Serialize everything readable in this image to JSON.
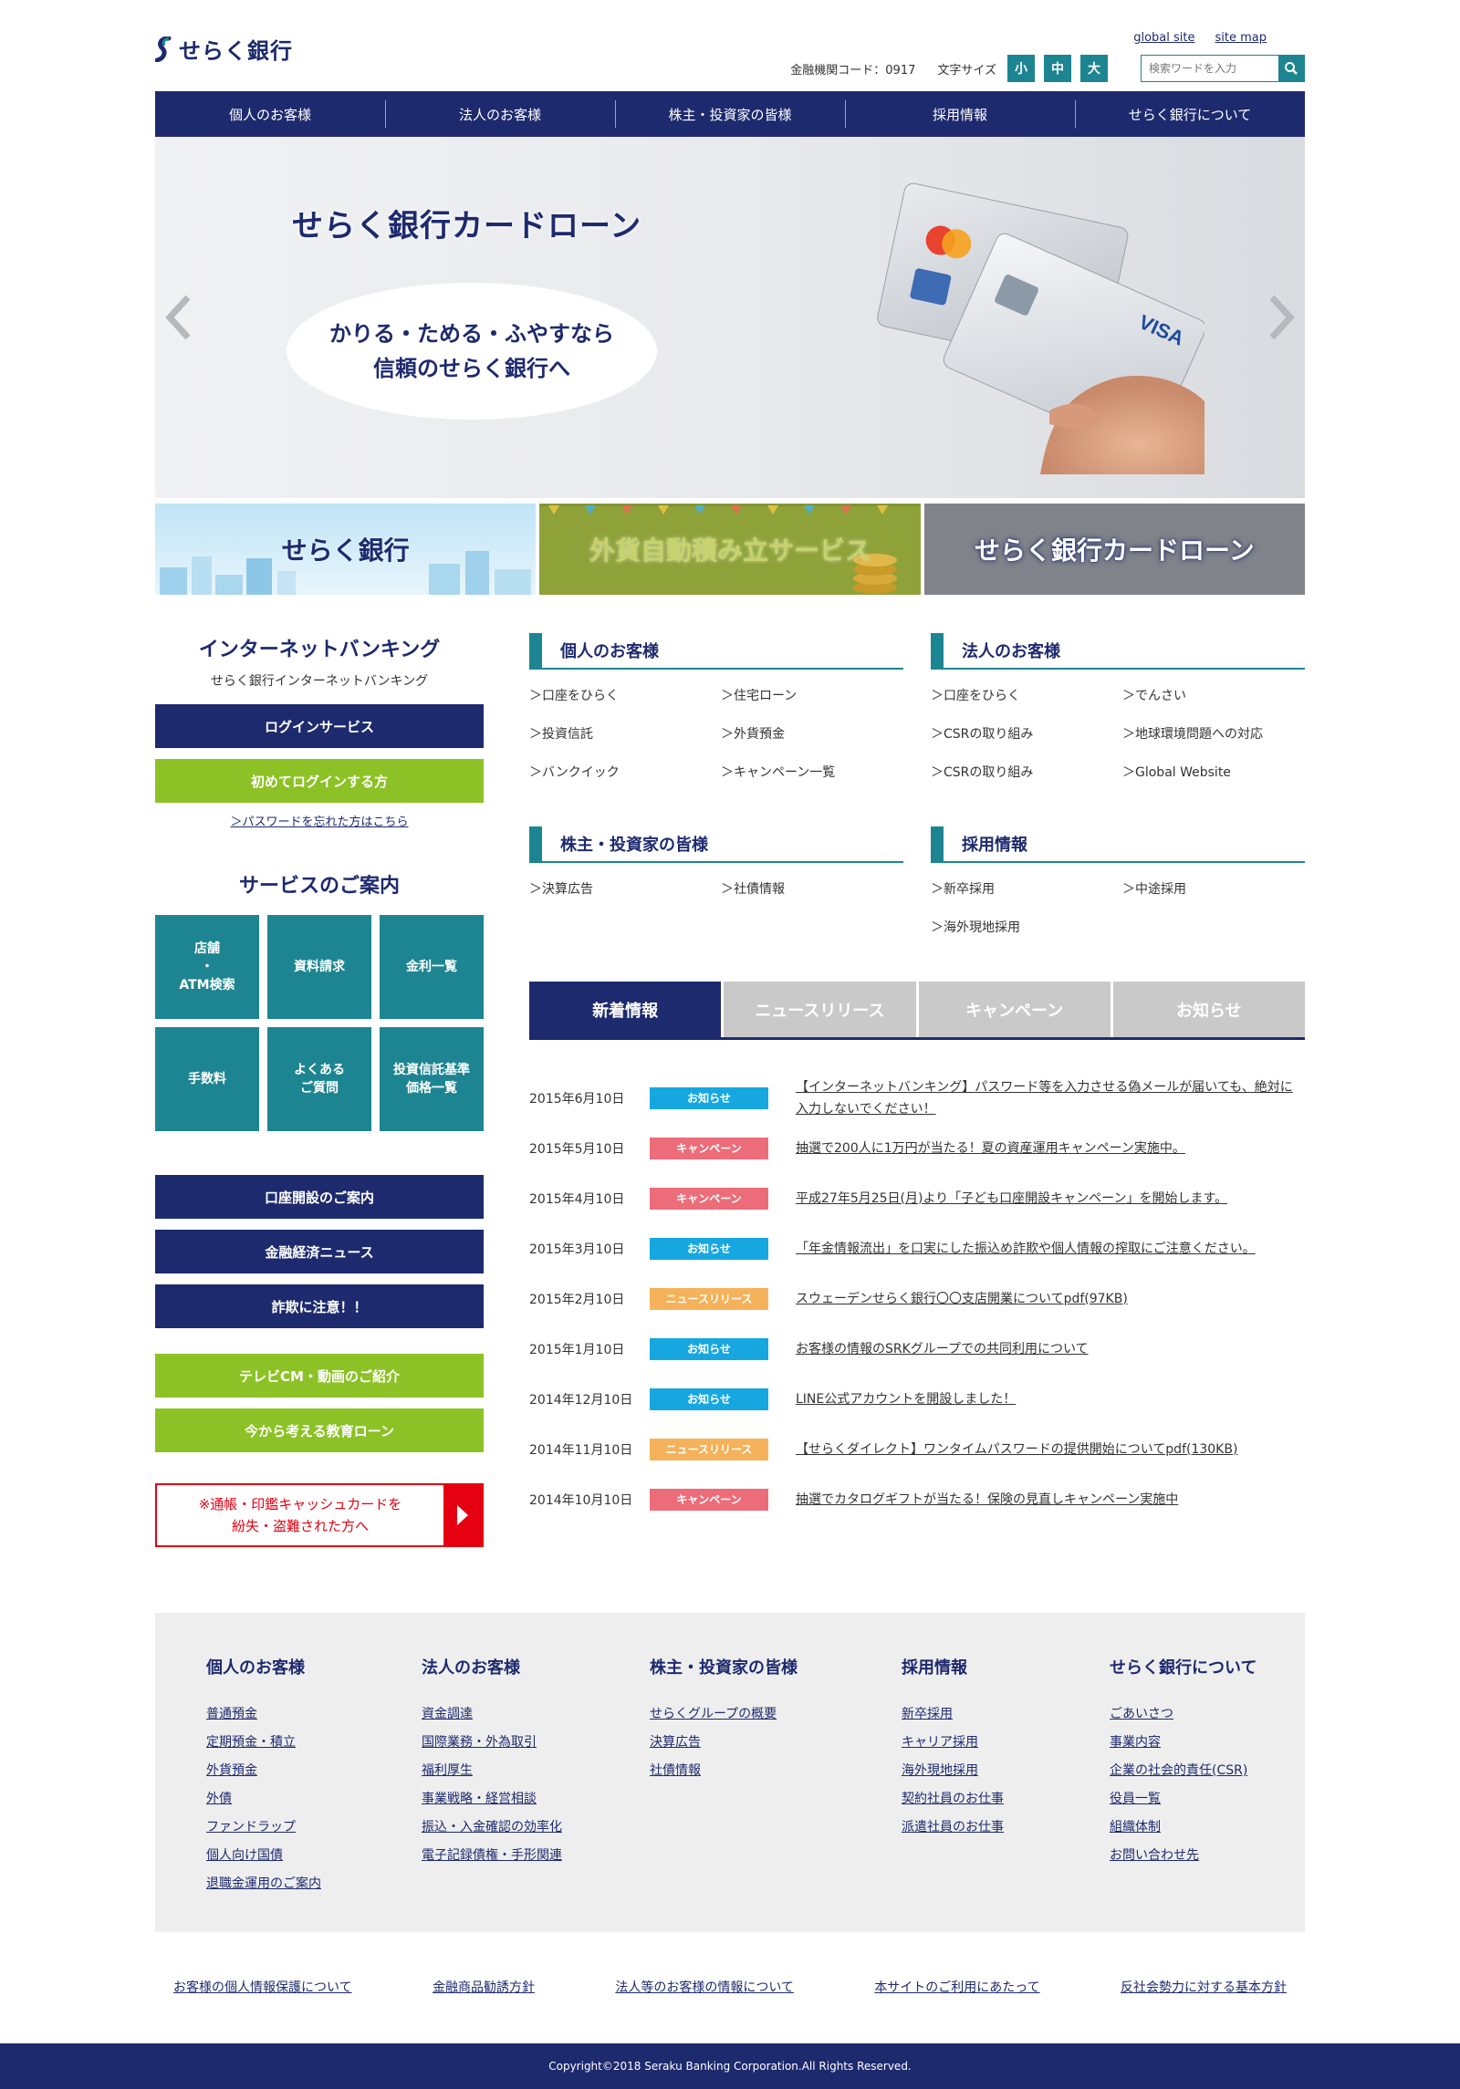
{
  "header": {
    "bank_name": "せらく銀行",
    "links": [
      "global site",
      "site map"
    ],
    "bank_code": "金融機関コード：0917",
    "font_size_label": "文字サイズ",
    "font_sizes": [
      "小",
      "中",
      "大"
    ],
    "search_placeholder": "検索ワードを入力"
  },
  "nav": [
    "個人のお客様",
    "法人のお客様",
    "株主・投資家の皆様",
    "採用情報",
    "せらく銀行について"
  ],
  "hero": {
    "title": "せらく銀行カードローン",
    "catch_line1": "かりる・ためる・ふやすなら",
    "catch_line2": "信頼のせらく銀行へ"
  },
  "banners": [
    "せらく銀行",
    "外貨自動積み立サービス",
    "せらく銀行カードローン"
  ],
  "sidebar": {
    "ib_title": "インターネットバンキング",
    "ib_sub": "せらく銀行インターネットバンキング",
    "login_btn": "ログインサービス",
    "first_login_btn": "初めてログインする方",
    "forgot": "＞パスワードを忘れた方はこちら",
    "service_title": "サービスのご案内",
    "tiles": [
      "店舗\n・\nATM検索",
      "資料請求",
      "金利一覧",
      "手数料",
      "よくある\nご質問",
      "投資信託基準\n価格一覧"
    ],
    "navy_buttons": [
      "口座開設のご案内",
      "金融経済ニュース",
      "詐欺に注意！！"
    ],
    "green_buttons": [
      "テレビCM・動画のご紹介",
      "今から考える教育ローン"
    ],
    "alert": "※通帳・印鑑キャッシュカードを\n紛失・盗難された方へ"
  },
  "sections": [
    {
      "title": "個人のお客様",
      "links": [
        "口座をひらく",
        "住宅ローン",
        "投資信託",
        "外貨預金",
        "バンクイック",
        "キャンペーン一覧"
      ]
    },
    {
      "title": "法人のお客様",
      "links": [
        "口座をひらく",
        "でんさい",
        "CSRの取り組み",
        "地球環境問題への対応",
        "CSRの取り組み",
        "Global Website"
      ]
    },
    {
      "title": "株主・投資家の皆様",
      "links": [
        "決算広告",
        "社債情報"
      ]
    },
    {
      "title": "採用情報",
      "links": [
        "新卒採用",
        "中途採用",
        "海外現地採用"
      ]
    }
  ],
  "tabs": [
    "新着情報",
    "ニュースリリース",
    "キャンペーン",
    "お知らせ"
  ],
  "news": [
    {
      "date": "2015年6月10日",
      "badge": "お知らせ",
      "type": "info",
      "text": "【インターネットバンキング】パスワード等を入力させる偽メールが届いても、絶対に入力しないでください！"
    },
    {
      "date": "2015年5月10日",
      "badge": "キャンペーン",
      "type": "camp",
      "text": "抽選で200人に1万円が当たる！夏の資産運用キャンペーン実施中。"
    },
    {
      "date": "2015年4月10日",
      "badge": "キャンペーン",
      "type": "camp",
      "text": "平成27年5月25日(月)より「子ども口座開設キャンペーン」を開始します。"
    },
    {
      "date": "2015年3月10日",
      "badge": "お知らせ",
      "type": "info",
      "text": "「年金情報流出」を口実にした振込め詐欺や個人情報の搾取にご注意ください。"
    },
    {
      "date": "2015年2月10日",
      "badge": "ニュースリリース",
      "type": "news",
      "text": "スウェーデンせらく銀行〇〇支店開業についてpdf(97KB)"
    },
    {
      "date": "2015年1月10日",
      "badge": "お知らせ",
      "type": "info",
      "text": "お客様の情報のSRKグループでの共同利用について"
    },
    {
      "date": "2014年12月10日",
      "badge": "お知らせ",
      "type": "info",
      "text": "LINE公式アカウントを開設しました！"
    },
    {
      "date": "2014年11月10日",
      "badge": "ニュースリリース",
      "type": "news",
      "text": "【せらくダイレクト】ワンタイムパスワードの提供開始についてpdf(130KB)"
    },
    {
      "date": "2014年10月10日",
      "badge": "キャンペーン",
      "type": "camp",
      "text": "抽選でカタログギフトが当たる！保険の見直しキャンペーン実施中"
    }
  ],
  "footer_menu": [
    {
      "title": "個人のお客様",
      "links": [
        "普通預金",
        "定期預金・積立",
        "外貨預金",
        "外債",
        "ファンドラップ",
        "個人向け国債",
        "退職金運用のご案内"
      ]
    },
    {
      "title": "法人のお客様",
      "links": [
        "資金調達",
        "国際業務・外為取引",
        "福利厚生",
        "事業戦略・経営相談",
        "振込・入金確認の効率化",
        "電子記録債権・手形関連"
      ]
    },
    {
      "title": "株主・投資家の皆様",
      "links": [
        "せらくグループの概要",
        "決算広告",
        "社債情報"
      ]
    },
    {
      "title": "採用情報",
      "links": [
        "新卒採用",
        "キャリア採用",
        "海外現地採用",
        "契約社員のお仕事",
        "派遣社員のお仕事"
      ]
    },
    {
      "title": "せらく銀行について",
      "links": [
        "ごあいさつ",
        "事業内容",
        "企業の社会的責任(CSR)",
        "役員一覧",
        "組織体制",
        "お問い合わせ先"
      ]
    }
  ],
  "footer_links": [
    "お客様の個人情報保護について",
    "金融商品勧誘方針",
    "法人等のお客様の情報について",
    "本サイトのご利用にあたって",
    "反社会勢力に対する基本方針"
  ],
  "copyright": "Copyright©2018 Seraku Banking Corporation.All Rights Reserved.",
  "colors": {
    "navy": "#1e2a6e",
    "teal": "#1d8591",
    "green": "#8cc225",
    "red": "#e50012",
    "info": "#16a7e0",
    "campaign": "#ec6d79",
    "newsrelease": "#f5b25a"
  }
}
